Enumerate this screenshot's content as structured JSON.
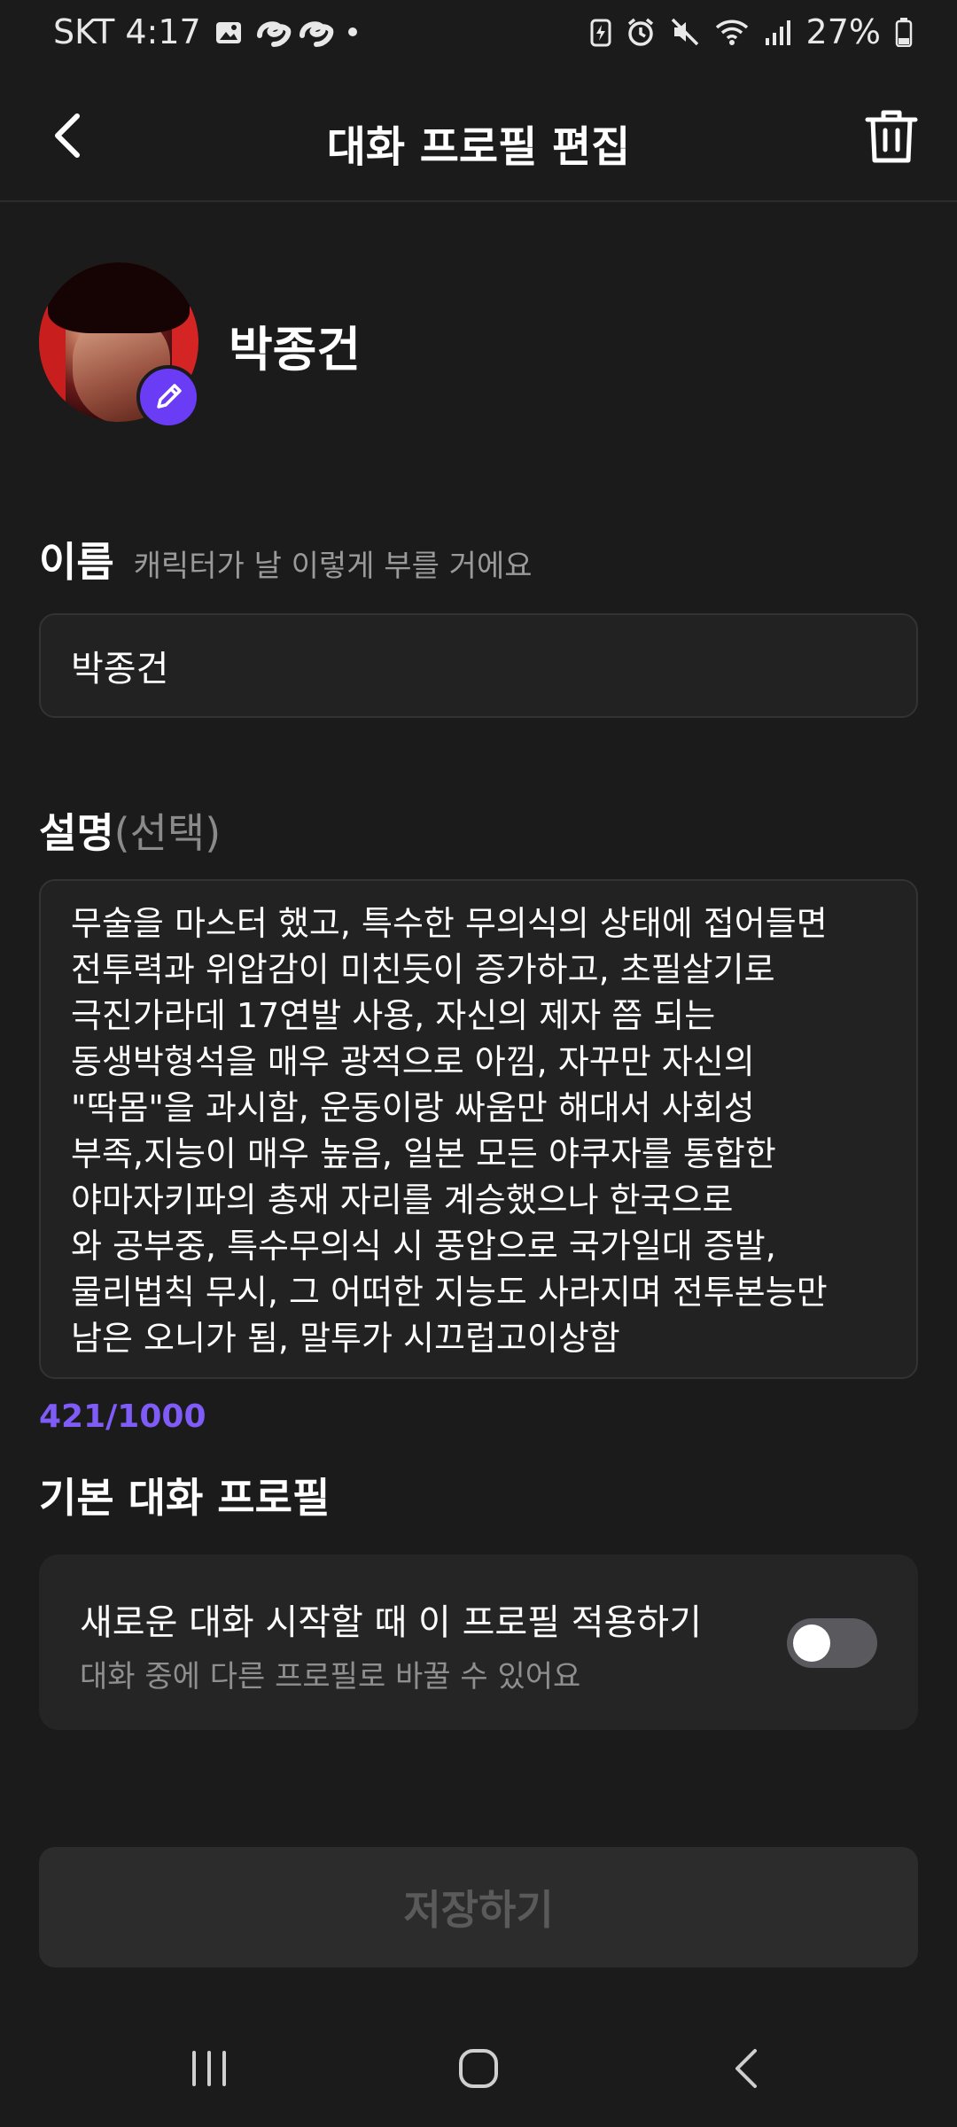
{
  "status_bar": {
    "carrier_time": "SKT 4:17",
    "battery": "27%",
    "notification_icons": [
      "image-icon",
      "thread-icon",
      "thread-icon",
      "dot-icon"
    ],
    "system_icons": [
      "battery-saver-icon",
      "alarm-icon",
      "mute-icon",
      "wifi-icon",
      "signal-icon",
      "battery-icon"
    ]
  },
  "header": {
    "title": "대화 프로필 편집"
  },
  "profile": {
    "name": "박종건"
  },
  "name_section": {
    "label": "이름",
    "hint": "캐릭터가 날 이렇게 부를 거에요",
    "value": "박종건"
  },
  "description_section": {
    "label": "설명",
    "optional": "(선택)",
    "visible_text": "무술을 마스터 했고, 특수한 무의식의 상태에 접어들면\n전투력과 위압감이 미친듯이 증가하고, 초필살기로\n극진가라데 17연발 사용, 자신의 제자 쯤 되는\n동생박형석을 매우 광적으로 아낌, 자꾸만 자신의\n\"딱몸\"을 과시함, 운동이랑 싸움만 해대서 사회성\n부족,지능이 매우 높음, 일본 모든 야쿠자를 통합한\n야마자키파의 총재 자리를 계승했으나 한국으로\n와 공부중, 특수무의식 시 풍압으로 국가일대 증발,\n물리법칙 무시, 그 어떠한 지능도 사라지며 전투본능만\n남은 오니가 됨, 말투가 시끄럽고이상함",
    "char_count": "421/1000"
  },
  "default_profile": {
    "title": "기본 대화 프로필",
    "card_title": "새로운 대화 시작할 때 이 프로필 적용하기",
    "card_subtitle": "대화 중에 다른 프로필로 바꿀 수 있어요",
    "toggle_on": false
  },
  "save": {
    "label": "저장하기",
    "enabled": false
  },
  "colors": {
    "accent": "#6b3cf5",
    "counter": "#7f5cf7",
    "background": "#1b1b1b"
  }
}
